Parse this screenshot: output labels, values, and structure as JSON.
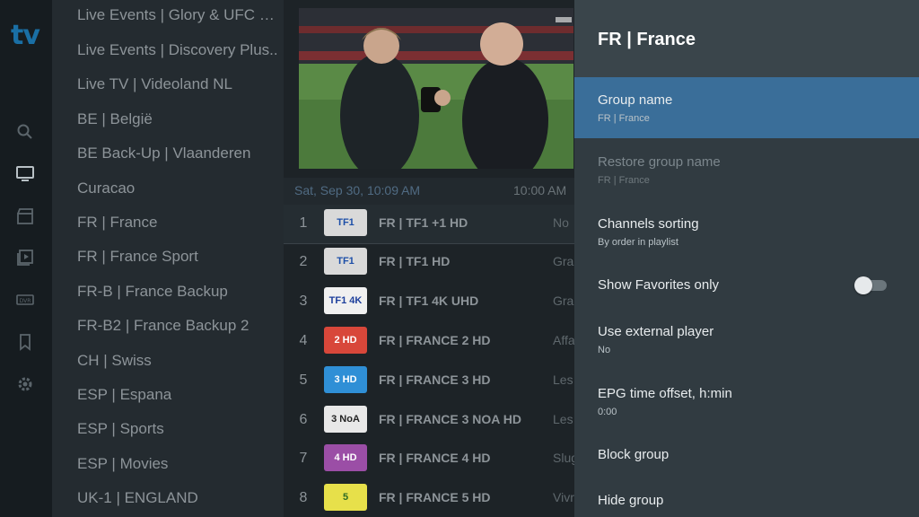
{
  "app": {
    "logo": "tv"
  },
  "rail": {
    "icons": [
      "search-icon",
      "tv-icon",
      "movie-clapper-icon",
      "video-library-icon",
      "dvr-icon",
      "bookmark-icon",
      "gear-icon"
    ]
  },
  "groups": [
    "Live Events | Glory & UFC an..",
    "Live Events | Discovery Plus..",
    "Live TV | Videoland NL",
    "BE | België",
    "BE Back-Up | Vlaanderen",
    "Curacao",
    "FR | France",
    "FR | France Sport",
    "FR-B | France Backup",
    "FR-B2 | France Backup 2",
    "CH | Swiss",
    "ESP | Espana",
    "ESP | Sports",
    "ESP | Movies",
    "UK-1 | ENGLAND"
  ],
  "epg": {
    "date": "Sat, Sep 30, 10:09 AM",
    "next_time": "10:00 AM"
  },
  "channels": [
    {
      "num": "1",
      "logo": "TF1",
      "name": "FR | TF1 +1 HD",
      "program": "No"
    },
    {
      "num": "2",
      "logo": "TF1",
      "name": "FR | TF1 HD",
      "program": "Gra"
    },
    {
      "num": "3",
      "logo": "TF1 4K",
      "name": "FR | TF1 4K UHD",
      "program": "Gra"
    },
    {
      "num": "4",
      "logo": "2 HD",
      "name": "FR | FRANCE 2 HD",
      "program": "Affa"
    },
    {
      "num": "5",
      "logo": "3 HD",
      "name": "FR | FRANCE 3 HD",
      "program": "Les"
    },
    {
      "num": "6",
      "logo": "3 NoA",
      "name": "FR | FRANCE 3 NOA HD",
      "program": "Les"
    },
    {
      "num": "7",
      "logo": "4 HD",
      "name": "FR | FRANCE 4 HD",
      "program": "Slug"
    },
    {
      "num": "8",
      "logo": "5",
      "name": "FR | FRANCE 5 HD",
      "program": "Vivr"
    }
  ],
  "panel": {
    "title": "FR | France",
    "settings": [
      {
        "label": "Group name",
        "value": "FR | France"
      },
      {
        "label": "Restore group name",
        "value": "FR | France"
      },
      {
        "label": "Channels sorting",
        "value": "By order in playlist"
      },
      {
        "label": "Show Favorites only",
        "value": ""
      },
      {
        "label": "Use external player",
        "value": "No"
      },
      {
        "label": "EPG time offset, h:min",
        "value": "0:00"
      },
      {
        "label": "Block group",
        "value": ""
      },
      {
        "label": "Hide group",
        "value": ""
      }
    ],
    "favorites_only": false
  },
  "colors": {
    "accent": "#3a6e99",
    "logo": "#1a6fa5"
  }
}
